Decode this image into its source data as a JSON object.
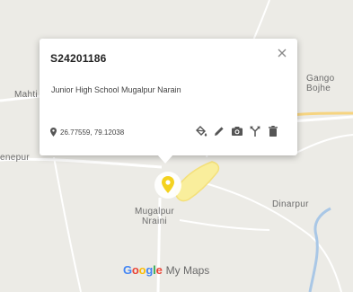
{
  "map": {
    "labels": {
      "mahti": "Mahti",
      "enepur": "enepur",
      "gango": "Gango",
      "bojhe": "Bojhe",
      "mugalpur_line1": "Mugalpur",
      "mugalpur_line2": "Nraini",
      "dinarpur": "Dinarpur"
    },
    "colors": {
      "land": "#ecebe6",
      "road": "#ffffff",
      "highway": "#f6d480",
      "water": "#a9c7e6",
      "marker": "#f4d21f",
      "area_fill": "#f9ee9c"
    }
  },
  "popup": {
    "title": "S24201186",
    "description": "Junior High School Mugalpur Narain",
    "coordinates": "26.77559, 79.12038",
    "close_icon": "close-icon",
    "tools": [
      "paint-bucket-icon",
      "pencil-icon",
      "camera-icon",
      "directions-icon",
      "trash-icon"
    ]
  },
  "branding": {
    "google": [
      "G",
      "o",
      "o",
      "g",
      "l",
      "e"
    ],
    "google_colors": [
      "#4285f4",
      "#ea4335",
      "#fbbc05",
      "#4285f4",
      "#34a853",
      "#ea4335"
    ],
    "product": "My Maps"
  }
}
